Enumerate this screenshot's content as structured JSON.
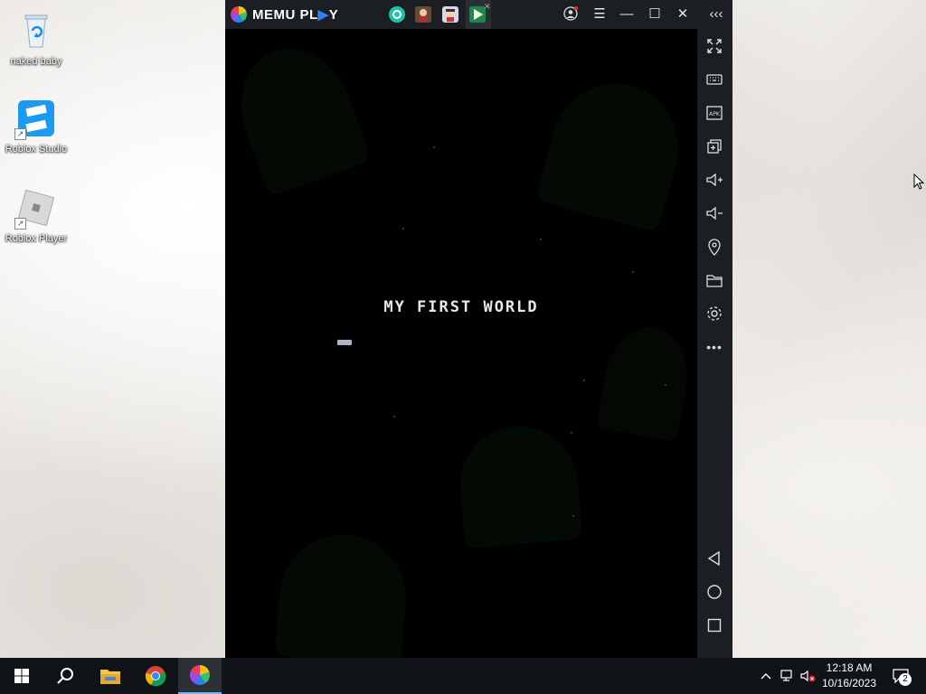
{
  "desktop": {
    "icons": [
      {
        "label": "naked baby",
        "icon": "recycle-bin-icon"
      },
      {
        "label": "Roblox Studio",
        "icon": "roblox-studio-icon"
      },
      {
        "label": "Roblox Player",
        "icon": "roblox-player-icon"
      }
    ]
  },
  "memu": {
    "brand": "MEMU PL",
    "brand_suffix": "Y",
    "tabs": [
      {
        "icon": "green-app-icon"
      },
      {
        "icon": "character-app-icon"
      },
      {
        "icon": "pixel-app-icon"
      },
      {
        "icon": "play-store-icon",
        "active": true
      }
    ],
    "title_buttons": [
      "account-icon",
      "menu-icon",
      "minimize-icon",
      "maximize-icon",
      "close-icon",
      "collapse-sidebar-icon"
    ],
    "sidebar_buttons": [
      "fullscreen-icon",
      "keyboard-icon",
      "apk-icon",
      "multi-instance-icon",
      "volume-up-icon",
      "volume-down-icon",
      "location-icon",
      "folder-icon",
      "settings-icon",
      "more-icon"
    ],
    "nav_buttons": [
      "back-icon",
      "home-icon",
      "recents-icon"
    ],
    "game": {
      "title": "MY FIRST WORLD"
    }
  },
  "taskbar": {
    "items": [
      "start-icon",
      "search-icon",
      "file-explorer-icon",
      "chrome-icon",
      "memu-icon"
    ],
    "clock": {
      "time": "12:18 AM",
      "date": "10/16/2023"
    },
    "notification_count": "2"
  }
}
